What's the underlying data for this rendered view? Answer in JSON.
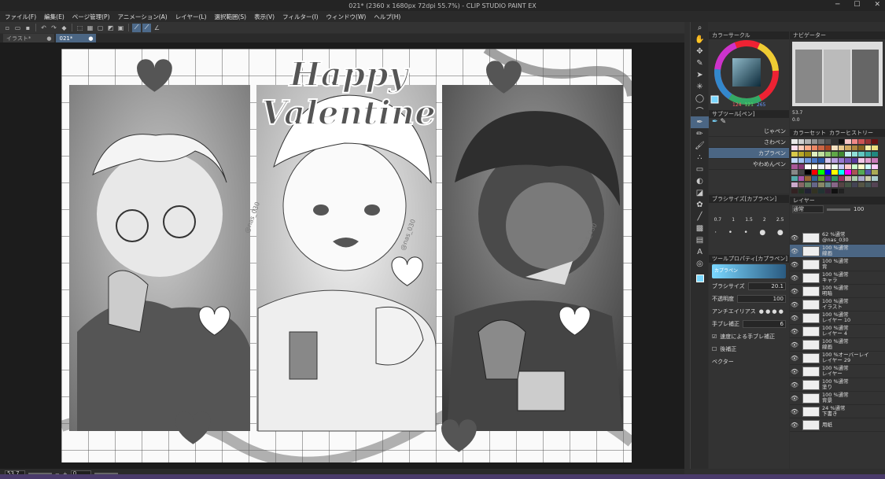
{
  "title": "021* (2360 x 1680px 72dpi 55.7%) - CLIP STUDIO PAINT EX",
  "menu": [
    "ファイル(F)",
    "編集(E)",
    "ページ管理(P)",
    "アニメーション(A)",
    "レイヤー(L)",
    "選択範囲(S)",
    "表示(V)",
    "フィルター(I)",
    "ウィンドウ(W)",
    "ヘルプ(H)"
  ],
  "tabs": [
    "イラスト*",
    "021*"
  ],
  "status": {
    "zoom": "53.7",
    "angle": "0"
  },
  "canvas_title": "Happy Valentine",
  "watermarks": [
    "@nas_030",
    "@nas_030",
    "@nas_030"
  ],
  "panels": {
    "color_circle": "カラーサークル",
    "color_values": [
      "124",
      "121",
      "265"
    ],
    "navigator": "ナビゲーター",
    "nav_values": [
      "53.7",
      "0.0"
    ],
    "subtool": "サブツール[ペン]",
    "brushes": [
      "じゃペン",
      "さわペン",
      "カプラペン",
      "やわめんペン"
    ],
    "brush_size_title": "ブラシサイズ[カプラペン]",
    "sizes": [
      "0.7",
      "1",
      "1.5",
      "2",
      "2.5"
    ],
    "tool_property": "ツールプロパティ[カプラペン]",
    "tool_property_name": "カプラペン",
    "brush_size_label": "ブラシサイズ",
    "brush_size_value": "20.1",
    "opacity_label": "不透明度",
    "opacity_value": "100",
    "antialias_label": "アンチエイリアス",
    "stab_label": "手ブレ補正",
    "stab_value": "6",
    "speed_label": "速度による手ブレ補正",
    "post_label": "後補正",
    "vector_label": "ベクター",
    "color_set": "カラーセット",
    "color_history": "カラーヒストリー",
    "layer_tab": "レイヤー",
    "blend_mode": "通常",
    "layer_opacity": "100"
  },
  "layers": [
    {
      "name": "62 %通常\n@nas_030",
      "sel": false
    },
    {
      "name": "100 %通常\n線画",
      "sel": true
    },
    {
      "name": "100 %通常\n背",
      "sel": false
    },
    {
      "name": "100 %通常\nキャラ",
      "sel": false
    },
    {
      "name": "100 %通常\n明暗",
      "sel": false
    },
    {
      "name": "100 %通常\nイラスト",
      "sel": false
    },
    {
      "name": "100 %通常\nレイヤー 10",
      "sel": false
    },
    {
      "name": "100 %通常\nレイヤー 4",
      "sel": false
    },
    {
      "name": "100 %通常\n線画",
      "sel": false
    },
    {
      "name": "100 %オーバーレイ\nレイヤー 29",
      "sel": false
    },
    {
      "name": "100 %通常\nレイヤー",
      "sel": false
    },
    {
      "name": "100 %通常\n塗り",
      "sel": false
    },
    {
      "name": "100 %通常\n背景",
      "sel": false
    },
    {
      "name": "24 %通常\n下書き",
      "sel": false
    },
    {
      "name": "用紙",
      "sel": false
    }
  ],
  "swatch_colors": [
    "#e8e8e8",
    "#d0d0d0",
    "#b0b0b0",
    "#909090",
    "#707070",
    "#505050",
    "#303030",
    "#101010",
    "#f4c4c4",
    "#e88",
    "#c55",
    "#933",
    "#611",
    "#fde",
    "#fcb",
    "#fa8",
    "#e86",
    "#c64",
    "#a42",
    "#f4e0c0",
    "#e8c890",
    "#d0a860",
    "#b08840",
    "#886620",
    "#f8f0a8",
    "#eee080",
    "#d8c848",
    "#b8a828",
    "#988818",
    "#e0f0c0",
    "#c0e0a0",
    "#90c870",
    "#60a848",
    "#408830",
    "#c0f0e8",
    "#90e0d8",
    "#60c8c0",
    "#38a8a0",
    "#208880",
    "#c0d8f8",
    "#a0c0f0",
    "#7098e0",
    "#4878c8",
    "#2858a8",
    "#d8c8f0",
    "#b8a0e0",
    "#9878d0",
    "#7858b8",
    "#5838a0",
    "#f0c8e8",
    "#e0a0d0",
    "#c878b8",
    "#a85898",
    "#883878",
    "#fff",
    "#ffe",
    "#eef",
    "#fee",
    "#efe",
    "#ccf",
    "#fcc",
    "#cfc",
    "#ffc",
    "#cff",
    "#fcf",
    "#888",
    "#444",
    "#000",
    "#f00",
    "#0f0",
    "#00f",
    "#ff0",
    "#0ff",
    "#f0f",
    "#a55",
    "#5a5",
    "#55a",
    "#aa5",
    "#5aa",
    "#a5a",
    "#963",
    "#369",
    "#693",
    "#639",
    "#396",
    "#936",
    "#caa",
    "#aca",
    "#aac",
    "#cca",
    "#acc",
    "#cac",
    "#866",
    "#686",
    "#668",
    "#886",
    "#688",
    "#868",
    "#544",
    "#454",
    "#445",
    "#554",
    "#455",
    "#545",
    "#322",
    "#232",
    "#223",
    "#332",
    "#233",
    "#323",
    "#111",
    "#222",
    "#333"
  ]
}
